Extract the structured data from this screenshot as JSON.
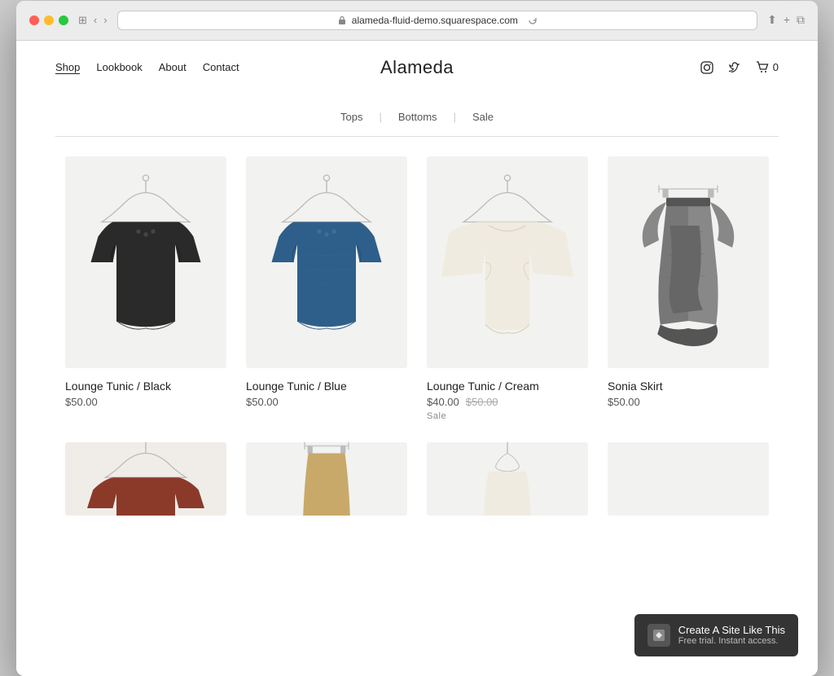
{
  "browser": {
    "url": "alameda-fluid-demo.squarespace.com"
  },
  "nav": {
    "links": [
      {
        "label": "Shop",
        "active": true
      },
      {
        "label": "Lookbook",
        "active": false
      },
      {
        "label": "About",
        "active": false
      },
      {
        "label": "Contact",
        "active": false
      }
    ],
    "site_title": "Alameda",
    "cart_count": "0"
  },
  "filters": {
    "tabs": [
      "Tops",
      "Bottoms",
      "Sale"
    ]
  },
  "products": [
    {
      "name": "Lounge Tunic / Black",
      "price": "$50.00",
      "original_price": null,
      "sale": false,
      "color": "black"
    },
    {
      "name": "Lounge Tunic / Blue",
      "price": "$50.00",
      "original_price": null,
      "sale": false,
      "color": "blue"
    },
    {
      "name": "Lounge Tunic / Cream",
      "price": "$40.00",
      "original_price": "$50.00",
      "sale": true,
      "color": "cream"
    },
    {
      "name": "Sonia Skirt",
      "price": "$50.00",
      "original_price": null,
      "sale": false,
      "color": "gray"
    }
  ],
  "promo": {
    "title": "Create A Site Like This",
    "subtitle": "Free trial. Instant access."
  }
}
